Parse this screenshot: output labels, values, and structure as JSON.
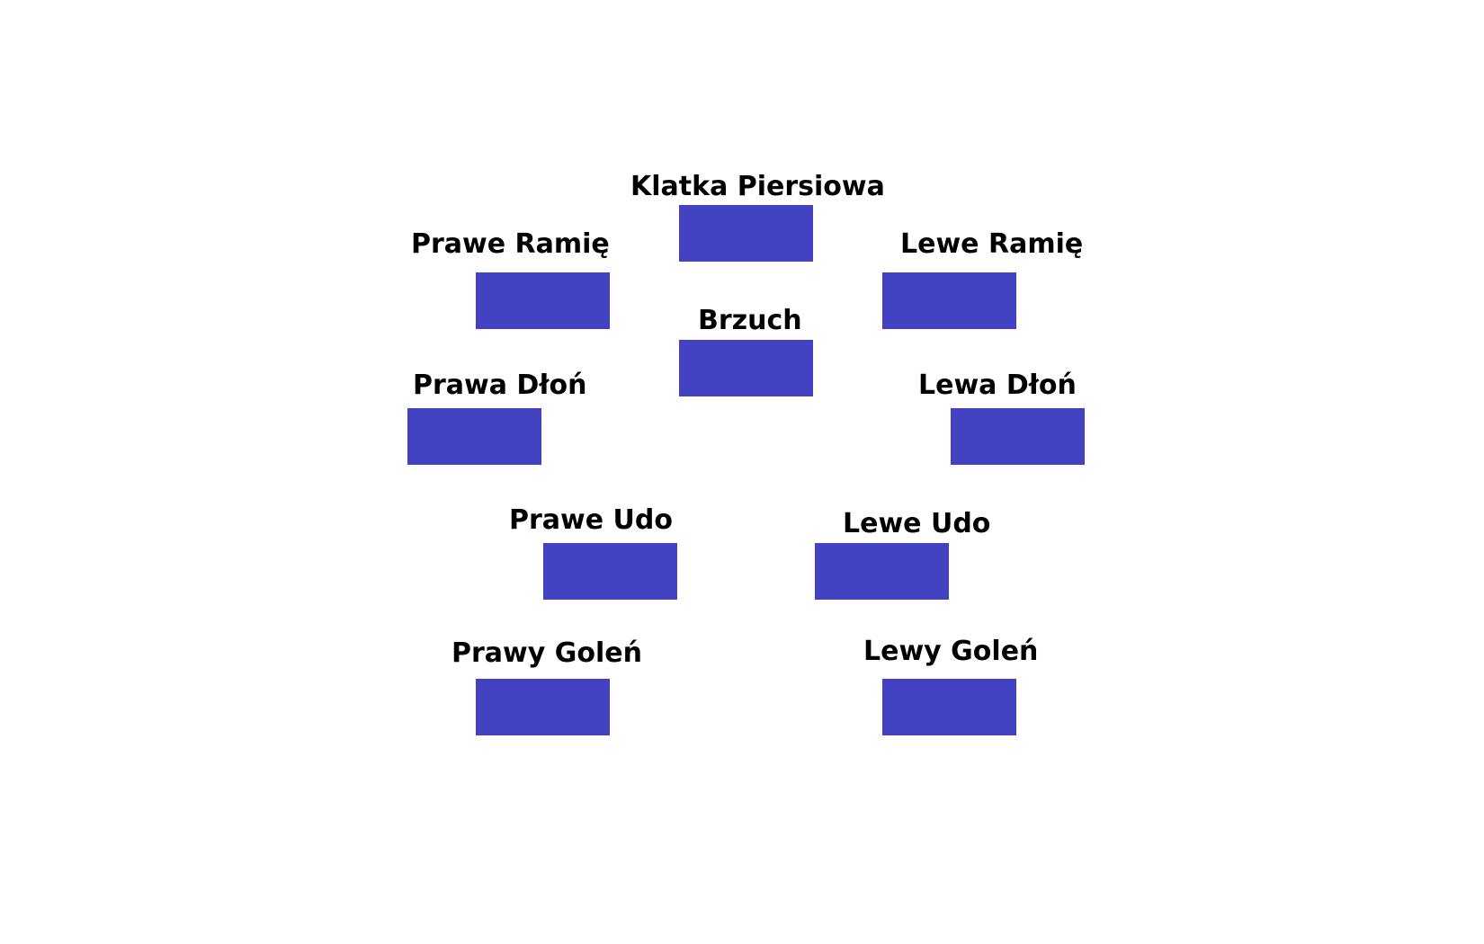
{
  "box_color": "#4242c2",
  "body_parts": {
    "klatka_piersiowa": "Klatka Piersiowa",
    "prawe_ramie": "Prawe Ramię",
    "lewe_ramie": "Lewe Ramię",
    "brzuch": "Brzuch",
    "prawa_dlon": "Prawa Dłoń",
    "lewa_dlon": "Lewa Dłoń",
    "prawe_udo": "Prawe Udo",
    "lewe_udo": "Lewe Udo",
    "prawy_golen": "Prawy Goleń",
    "lewy_golen": "Lewy Goleń"
  }
}
